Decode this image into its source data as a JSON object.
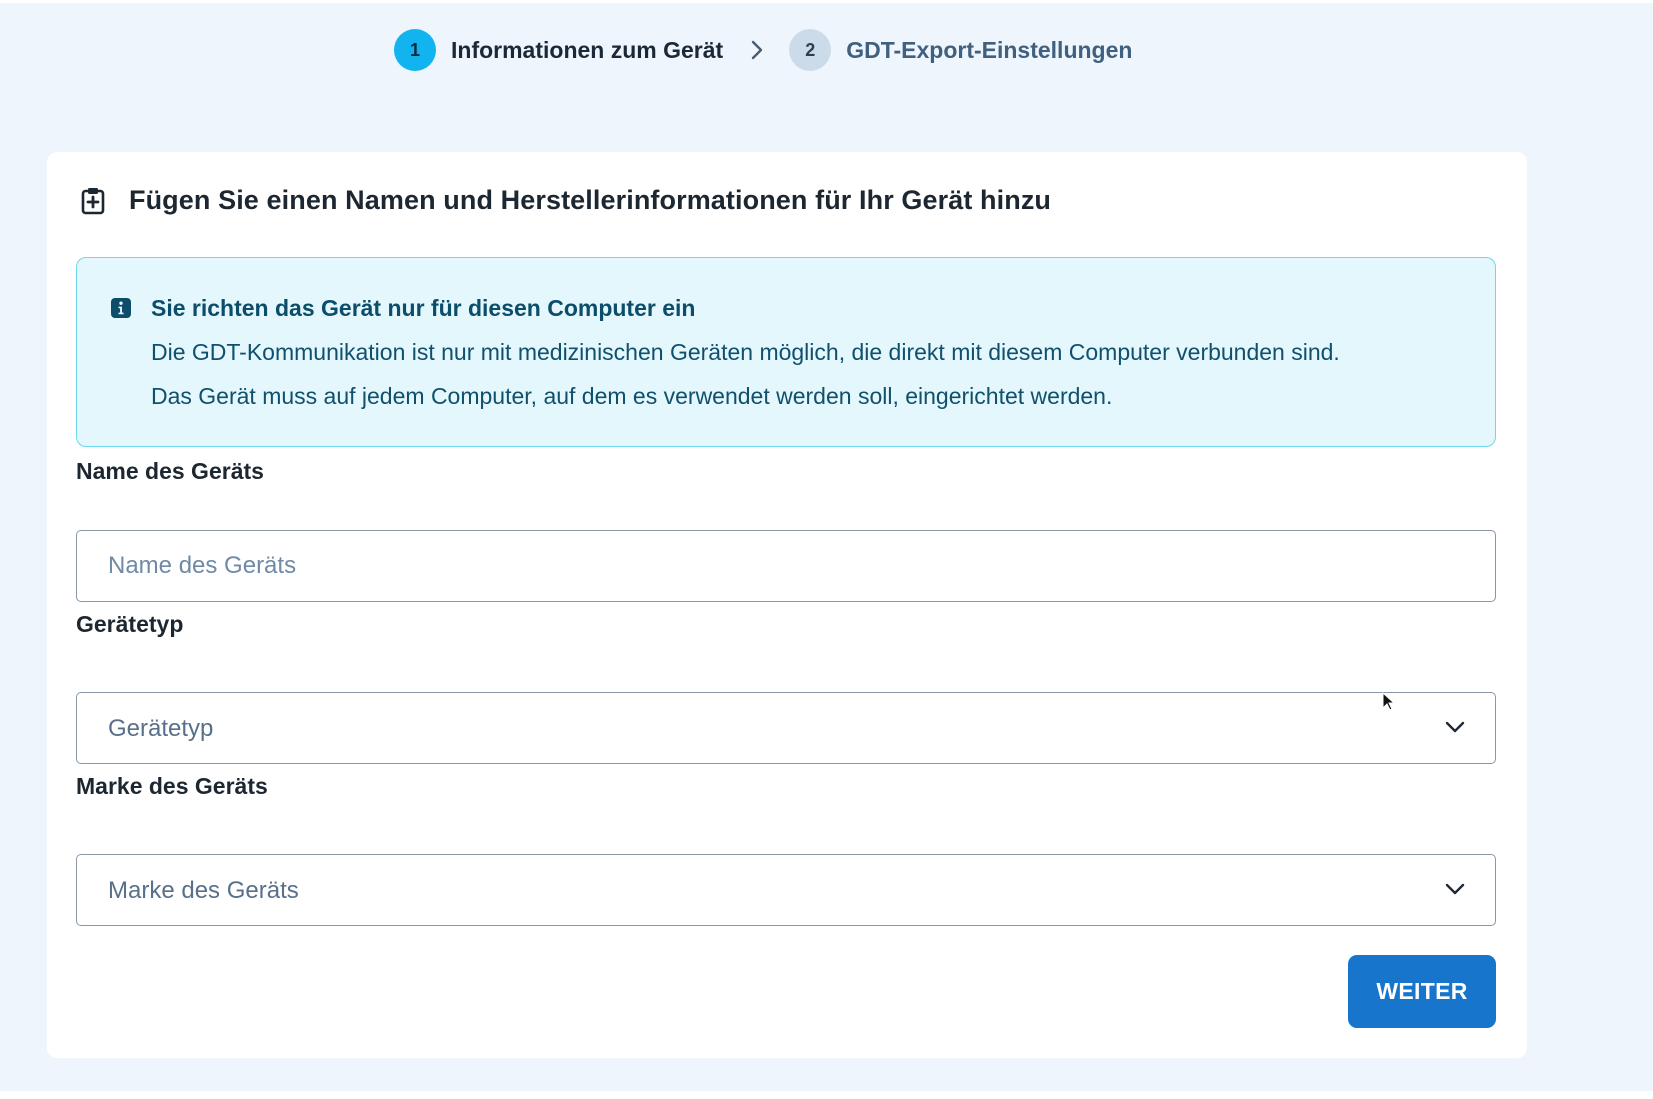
{
  "stepper": {
    "steps": [
      {
        "number": "1",
        "label": "Informationen zum Gerät",
        "state": "active"
      },
      {
        "number": "2",
        "label": "GDT-Export-Einstellungen",
        "state": "inactive"
      }
    ],
    "separator_icon": "chevron-right-icon"
  },
  "card": {
    "icon": "clipboard-plus-icon",
    "title": "Fügen Sie einen Namen und Herstellerinformationen für Ihr Gerät hinzu"
  },
  "alert": {
    "icon": "info-icon",
    "title": "Sie richten das Gerät nur für diesen Computer ein",
    "line1": "Die GDT-Kommunikation ist nur mit medizinischen Geräten möglich, die direkt mit diesem Computer verbunden sind.",
    "line2": "Das Gerät muss auf jedem Computer, auf dem es verwendet werden soll, eingerichtet werden."
  },
  "form": {
    "device_name": {
      "label": "Name des Geräts",
      "placeholder": "Name des Geräts",
      "value": ""
    },
    "device_type": {
      "label": "Gerätetyp",
      "placeholder": "Gerätetyp",
      "icon": "chevron-down-icon"
    },
    "device_brand": {
      "label": "Marke des Geräts",
      "placeholder": "Marke des Geräts",
      "icon": "chevron-down-icon"
    }
  },
  "actions": {
    "next_label": "WEITER"
  },
  "colors": {
    "page_background": "#eef5fc",
    "step_active": "#12b4f0",
    "step_inactive": "#ccdbe9",
    "alert_background": "#e3f7fc",
    "alert_border": "#6fd6ef",
    "primary_button": "#1776cc"
  }
}
